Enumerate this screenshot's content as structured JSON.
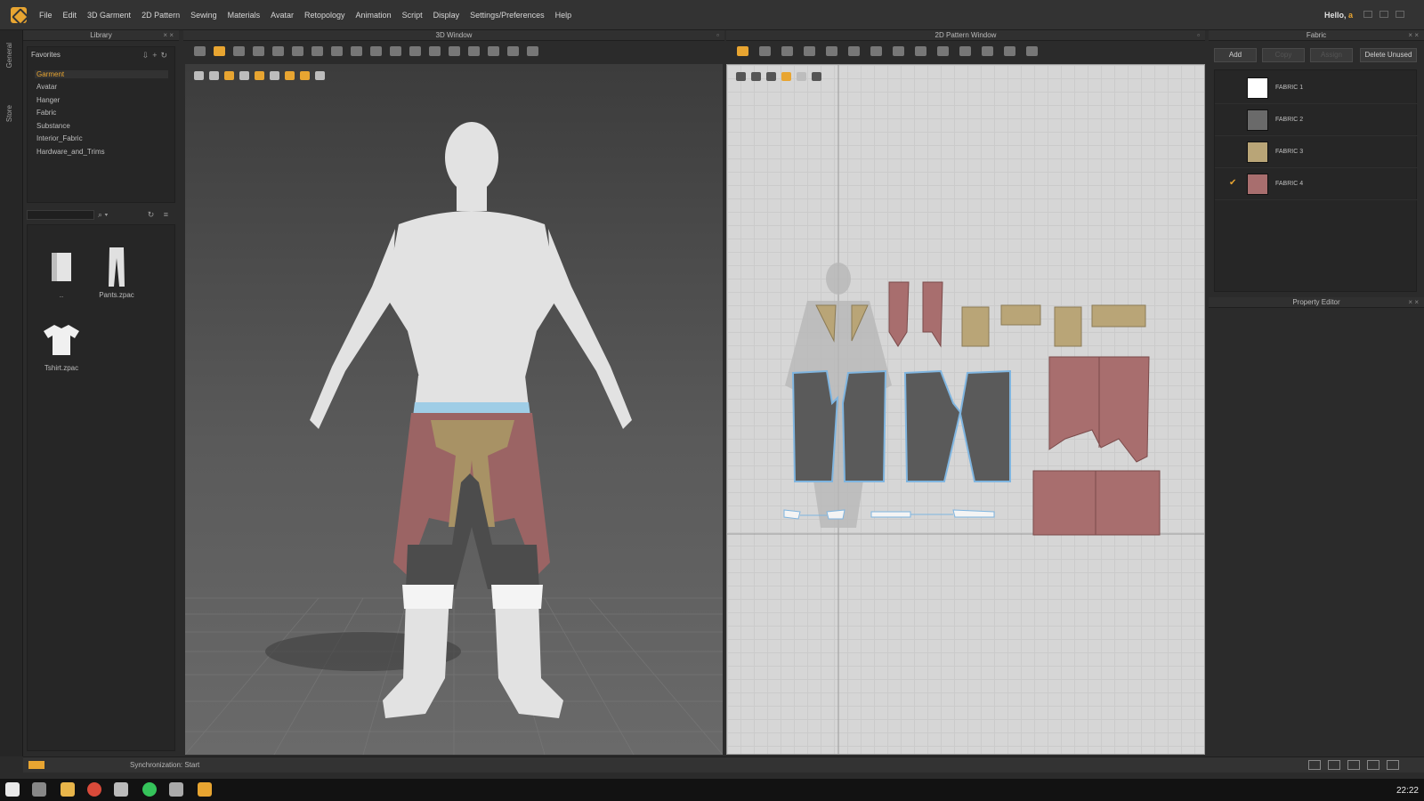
{
  "menu": [
    "File",
    "Edit",
    "3D Garment",
    "2D Pattern",
    "Sewing",
    "Materials",
    "Avatar",
    "Retopology",
    "Animation",
    "Script",
    "Display",
    "Settings/Preferences",
    "Help"
  ],
  "greeting": {
    "prefix": "Hello,",
    "user": "a"
  },
  "vertical_tabs": {
    "general": "General",
    "store": "Store"
  },
  "library": {
    "title": "Library",
    "favorites_title": "Favorites",
    "tree": [
      "Garment",
      "Avatar",
      "Hanger",
      "Fabric",
      "Substance",
      "Interior_Fabric",
      "Hardware_and_Trims"
    ],
    "selected": "Garment",
    "files": [
      {
        "name": "..",
        "icon": "folder-up-icon"
      },
      {
        "name": "Pants.zpac",
        "icon": "pants-icon"
      },
      {
        "name": "Tshirt.zpac",
        "icon": "tshirt-icon"
      }
    ]
  },
  "window3d": {
    "title": "3D Window"
  },
  "window2d": {
    "title": "2D Pattern Window"
  },
  "fabric_panel": {
    "title": "Fabric",
    "buttons": {
      "add": "Add",
      "copy": "Copy",
      "assign": "Assign",
      "delete_unused": "Delete Unused"
    },
    "fabrics": [
      {
        "name": "FABRIC 1",
        "color": "#ffffff",
        "checked": false
      },
      {
        "name": "FABRIC 2",
        "color": "#6a6a6a",
        "checked": false
      },
      {
        "name": "FABRIC 3",
        "color": "#b9a577",
        "checked": false
      },
      {
        "name": "FABRIC 4",
        "color": "#a86e6e",
        "checked": true
      }
    ]
  },
  "property_editor": {
    "title": "Property Editor"
  },
  "status": {
    "text": "Synchronization: Start"
  },
  "taskbar": {
    "clock": "22:22"
  },
  "colors": {
    "accent": "#e8a531",
    "fabric_maroon": "#9b6464",
    "fabric_tan": "#b9a577",
    "fabric_gray": "#5a5a5a",
    "selection_blue": "#7fb5e0"
  }
}
